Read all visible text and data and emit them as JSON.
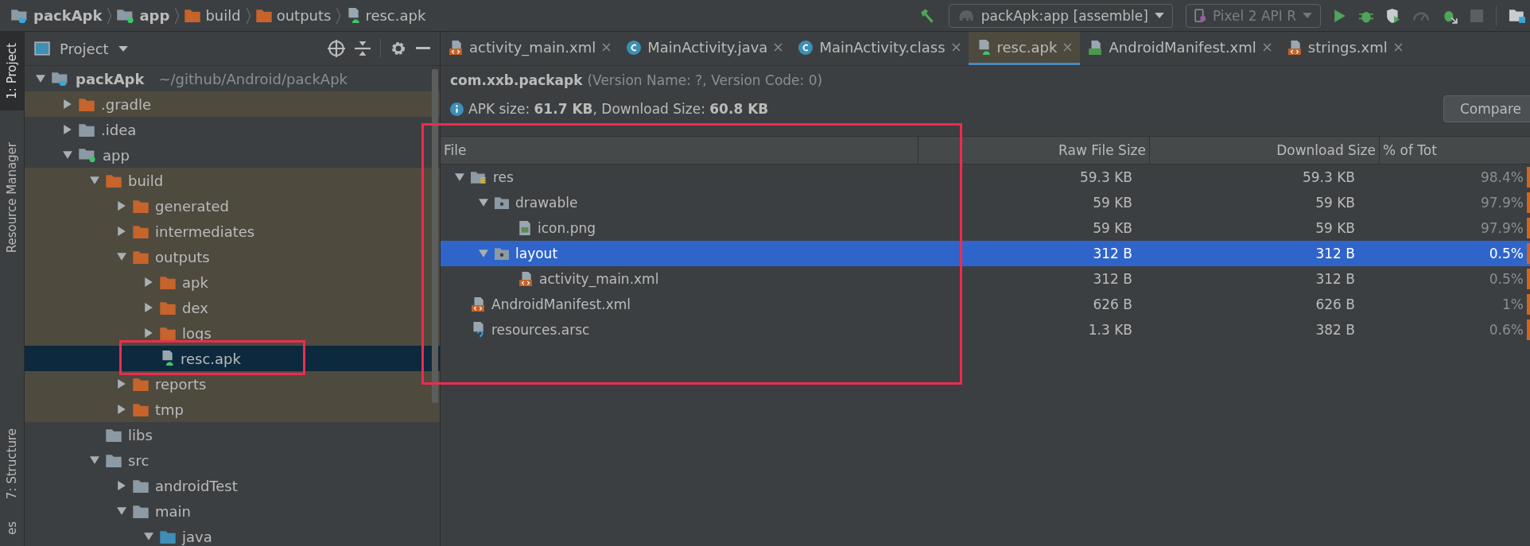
{
  "breadcrumbs": [
    {
      "label": "packApk",
      "kind": "project"
    },
    {
      "label": "app",
      "kind": "module"
    },
    {
      "label": "build",
      "kind": "folder"
    },
    {
      "label": "outputs",
      "kind": "folder"
    },
    {
      "label": "resc.apk",
      "kind": "apk"
    }
  ],
  "run_config": {
    "label": "packApk:app [assemble]"
  },
  "device": {
    "label": "Pixel 2 API R",
    "disabled": true
  },
  "side_tabs": [
    {
      "label": "1: Project",
      "selected": true
    },
    {
      "label": "Resource Manager",
      "selected": false
    },
    {
      "label": "7: Structure",
      "selected": false
    },
    {
      "label": "es",
      "selected": false
    }
  ],
  "project_panel": {
    "title": "Project",
    "tree": [
      {
        "label": "packApk",
        "hint": "~/github/Android/packApk",
        "kind": "project",
        "expanded": true,
        "selected": false,
        "excluded": false,
        "children": [
          {
            "label": ".gradle",
            "kind": "folder",
            "color": "#c6642b",
            "expanded": false,
            "selected": false,
            "excluded": true
          },
          {
            "label": ".idea",
            "kind": "folder",
            "color": "#8c9aa5",
            "expanded": false,
            "selected": false,
            "excluded": false
          },
          {
            "label": "app",
            "kind": "module",
            "expanded": true,
            "selected": false,
            "excluded": false,
            "children": [
              {
                "label": "build",
                "kind": "folder",
                "color": "#c6642b",
                "expanded": true,
                "selected": false,
                "excluded": true,
                "children": [
                  {
                    "label": "generated",
                    "kind": "folder",
                    "color": "#c6642b",
                    "expanded": false,
                    "selected": false,
                    "excluded": true
                  },
                  {
                    "label": "intermediates",
                    "kind": "folder",
                    "color": "#c6642b",
                    "expanded": false,
                    "selected": false,
                    "excluded": true
                  },
                  {
                    "label": "outputs",
                    "kind": "folder",
                    "color": "#c6642b",
                    "expanded": true,
                    "selected": false,
                    "excluded": true,
                    "children": [
                      {
                        "label": "apk",
                        "kind": "folder",
                        "color": "#c6642b",
                        "expanded": false,
                        "selected": false,
                        "excluded": true
                      },
                      {
                        "label": "dex",
                        "kind": "folder",
                        "color": "#c6642b",
                        "expanded": false,
                        "selected": false,
                        "excluded": true
                      },
                      {
                        "label": "logs",
                        "kind": "folder",
                        "color": "#c6642b",
                        "expanded": false,
                        "selected": false,
                        "excluded": true
                      },
                      {
                        "label": "resc.apk",
                        "kind": "apk",
                        "selected": true,
                        "excluded": true
                      }
                    ]
                  },
                  {
                    "label": "reports",
                    "kind": "folder",
                    "color": "#c6642b",
                    "expanded": false,
                    "selected": false,
                    "excluded": true
                  },
                  {
                    "label": "tmp",
                    "kind": "folder",
                    "color": "#c6642b",
                    "expanded": false,
                    "selected": false,
                    "excluded": true
                  }
                ]
              },
              {
                "label": "libs",
                "kind": "folder",
                "color": "#8c9aa5",
                "selected": false,
                "excluded": false
              },
              {
                "label": "src",
                "kind": "folder",
                "color": "#8c9aa5",
                "expanded": true,
                "selected": false,
                "excluded": false,
                "children": [
                  {
                    "label": "androidTest",
                    "kind": "folder",
                    "color": "#8c9aa5",
                    "expanded": false,
                    "selected": false,
                    "excluded": false
                  },
                  {
                    "label": "main",
                    "kind": "folder",
                    "color": "#8c9aa5",
                    "expanded": true,
                    "selected": false,
                    "excluded": false,
                    "children": [
                      {
                        "label": "java",
                        "kind": "folder",
                        "color": "#3d8fb5",
                        "expanded": true,
                        "selected": false,
                        "excluded": false
                      }
                    ]
                  }
                ]
              }
            ]
          }
        ]
      }
    ]
  },
  "editor_tabs": [
    {
      "label": "activity_main.xml",
      "kind": "xml",
      "selected": false
    },
    {
      "label": "MainActivity.java",
      "kind": "class",
      "selected": false
    },
    {
      "label": "MainActivity.class",
      "kind": "class",
      "selected": false
    },
    {
      "label": "resc.apk",
      "kind": "apk",
      "selected": true
    },
    {
      "label": "AndroidManifest.xml",
      "kind": "manifest",
      "selected": false
    },
    {
      "label": "strings.xml",
      "kind": "xml",
      "selected": false
    }
  ],
  "apk_info": {
    "package": "com.xxb.packapk",
    "version": "(Version Name: ?, Version Code: 0)",
    "sizes": "APK size: **61.7 KB**, Download Size: **60.8 KB**",
    "compare_button": "Compare"
  },
  "table": {
    "columns": [
      "File",
      "Raw File Size",
      "Download Size",
      "% of Tot"
    ],
    "rows": [
      {
        "name": "res",
        "kind": "res",
        "expanded": true,
        "selected": false,
        "raw": "59.3 KB",
        "download": "59.3 KB",
        "percent": "98.4%",
        "children": [
          {
            "name": "drawable",
            "kind": "dir",
            "expanded": true,
            "selected": false,
            "raw": "59 KB",
            "download": "59 KB",
            "percent": "97.9%",
            "children": [
              {
                "name": "icon.png",
                "kind": "image",
                "selected": false,
                "raw": "59 KB",
                "download": "59 KB",
                "percent": "97.9%"
              }
            ]
          },
          {
            "name": "layout",
            "kind": "dir",
            "expanded": true,
            "selected": true,
            "raw": "312 B",
            "download": "312 B",
            "percent": "0.5%",
            "children": [
              {
                "name": "activity_main.xml",
                "kind": "xml",
                "selected": false,
                "raw": "312 B",
                "download": "312 B",
                "percent": "0.5%"
              }
            ]
          }
        ]
      },
      {
        "name": "AndroidManifest.xml",
        "kind": "xml",
        "selected": false,
        "raw": "626 B",
        "download": "626 B",
        "percent": "1%"
      },
      {
        "name": "resources.arsc",
        "kind": "unknown",
        "selected": false,
        "raw": "1.3 KB",
        "download": "382 B",
        "percent": "0.6%"
      }
    ]
  }
}
